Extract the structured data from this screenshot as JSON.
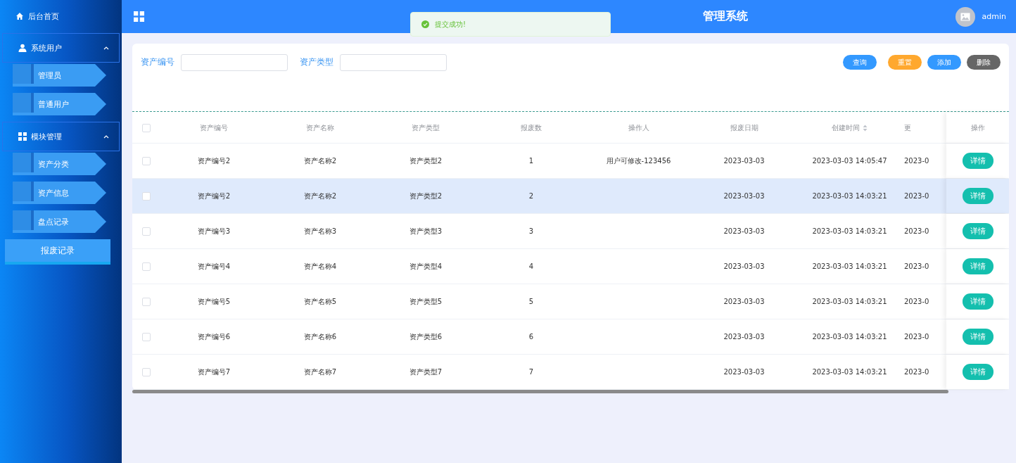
{
  "sidebar": {
    "home": {
      "label": "后台首页"
    },
    "groups": [
      {
        "label": "系统用户",
        "expanded": true,
        "items": [
          {
            "label": "管理员",
            "selected": false
          },
          {
            "label": "普通用户",
            "selected": false
          }
        ]
      },
      {
        "label": "模块管理",
        "expanded": true,
        "items": [
          {
            "label": "资产分类",
            "selected": false
          },
          {
            "label": "资产信息",
            "selected": false
          },
          {
            "label": "盘点记录",
            "selected": false
          },
          {
            "label": "报废记录",
            "selected": true
          }
        ]
      }
    ]
  },
  "header": {
    "title": "管理系统",
    "user": "admin"
  },
  "toast": {
    "message": "提交成功!"
  },
  "search": {
    "fields": [
      {
        "label": "资产编号"
      },
      {
        "label": "资产类型"
      }
    ],
    "buttons": [
      {
        "label": "查询",
        "kind": "primary"
      },
      {
        "label": "重置",
        "kind": "warning"
      },
      {
        "label": "添加",
        "kind": "primary"
      },
      {
        "label": "删除",
        "kind": "danger"
      }
    ]
  },
  "table": {
    "all_checked": false,
    "columns": [
      {
        "label": "资产编号",
        "sortable": false
      },
      {
        "label": "资产名称",
        "sortable": false
      },
      {
        "label": "资产类型",
        "sortable": false
      },
      {
        "label": "报废数",
        "sortable": false
      },
      {
        "label": "操作人",
        "sortable": false
      },
      {
        "label": "报废日期",
        "sortable": false
      },
      {
        "label": "创建时间",
        "sortable": true
      },
      {
        "label": "更",
        "sortable": false
      }
    ],
    "action_column": "操作",
    "rows": [
      {
        "checked": false,
        "highlighted": false,
        "cells": [
          "资产编号2",
          "资产名称2",
          "资产类型2",
          "1",
          "用户可修改-123456",
          "2023-03-03",
          "2023-03-03 14:05:47",
          "2023-0"
        ],
        "action": "详情"
      },
      {
        "checked": false,
        "highlighted": true,
        "cells": [
          "资产编号2",
          "资产名称2",
          "资产类型2",
          "2",
          "",
          "2023-03-03",
          "2023-03-03 14:03:21",
          "2023-0"
        ],
        "action": "详情"
      },
      {
        "checked": false,
        "highlighted": false,
        "cells": [
          "资产编号3",
          "资产名称3",
          "资产类型3",
          "3",
          "",
          "2023-03-03",
          "2023-03-03 14:03:21",
          "2023-0"
        ],
        "action": "详情"
      },
      {
        "checked": false,
        "highlighted": false,
        "cells": [
          "资产编号4",
          "资产名称4",
          "资产类型4",
          "4",
          "",
          "2023-03-03",
          "2023-03-03 14:03:21",
          "2023-0"
        ],
        "action": "详情"
      },
      {
        "checked": false,
        "highlighted": false,
        "cells": [
          "资产编号5",
          "资产名称5",
          "资产类型5",
          "5",
          "",
          "2023-03-03",
          "2023-03-03 14:03:21",
          "2023-0"
        ],
        "action": "详情"
      },
      {
        "checked": false,
        "highlighted": false,
        "cells": [
          "资产编号6",
          "资产名称6",
          "资产类型6",
          "6",
          "",
          "2023-03-03",
          "2023-03-03 14:03:21",
          "2023-0"
        ],
        "action": "详情"
      },
      {
        "checked": false,
        "highlighted": false,
        "cells": [
          "资产编号7",
          "资产名称7",
          "资产类型7",
          "7",
          "",
          "2023-03-03",
          "2023-03-03 14:03:21",
          "2023-0"
        ],
        "action": "详情"
      }
    ]
  }
}
